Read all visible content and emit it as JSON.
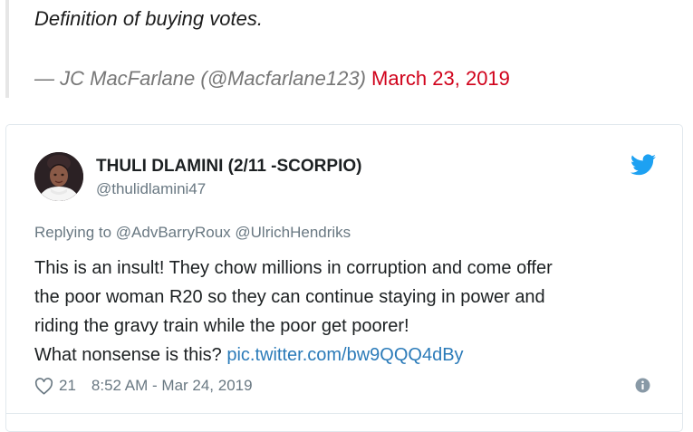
{
  "quote": {
    "text": "Definition of buying votes.",
    "cite_prefix": "— JC MacFarlane (@Macfarlane123)",
    "date": "March 23, 2019"
  },
  "tweet": {
    "author_name": "THULI DLAMINI (2/11 -SCORPIO)",
    "author_handle": "@thulidlamini47",
    "reply_prefix": "Replying to",
    "reply_to_1": "@AdvBarryRoux",
    "reply_to_2": "@UlrichHendriks",
    "text_lines": [
      "This is an insult! They chow millions in corruption and come offer",
      "the poor woman R20 so they can continue staying in power and",
      "riding the gravy train while the poor get poorer!"
    ],
    "last_line_text": "What nonsense is this?",
    "link": "pic.twitter.com/bw9QQQ4dBy",
    "like_count": "21",
    "timestamp": "8:52 AM - Mar 24, 2019"
  },
  "colors": {
    "date_red": "#d0021b",
    "twitter_blue": "#1da1f2",
    "link_blue": "#2b7bb9",
    "muted": "#697882"
  },
  "icons": {
    "brand": "twitter-bird-icon",
    "like": "heart-icon",
    "info": "info-icon"
  }
}
